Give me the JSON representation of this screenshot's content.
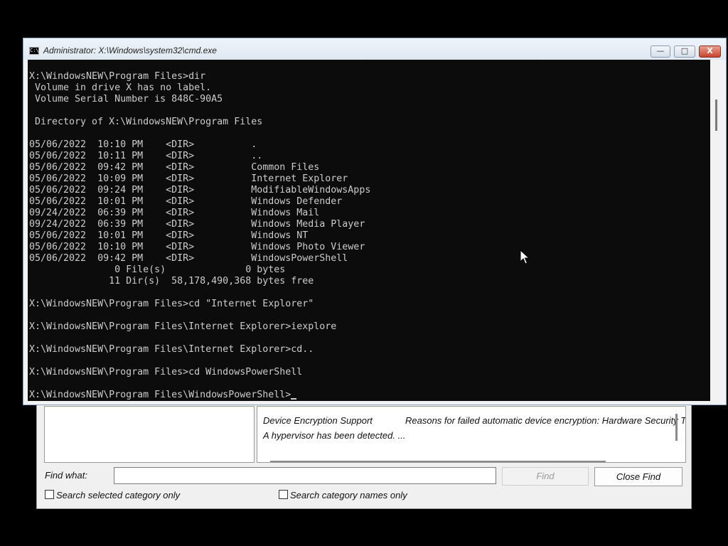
{
  "msinfo": {
    "row1_item": "Device Encryption Support",
    "row1_value": "Reasons for failed automatic device encryption: Hardware Security T",
    "row2_value": "A hypervisor has been detected. ...",
    "find_what_label": "Find what:",
    "find_what_value": "",
    "find_button": "Find",
    "close_find_button": "Close Find",
    "search_selected_label": "Search selected category only",
    "search_names_label": "Search category names only"
  },
  "cmd": {
    "title": "Administrator: X:\\Windows\\system32\\cmd.exe",
    "minimize_label": "—",
    "maximize_label": "□",
    "close_label": "X",
    "console_lines": [
      "",
      "X:\\WindowsNEW\\Program Files>dir",
      " Volume in drive X has no label.",
      " Volume Serial Number is 848C-90A5",
      "",
      " Directory of X:\\WindowsNEW\\Program Files",
      "",
      "05/06/2022  10:10 PM    <DIR>          .",
      "05/06/2022  10:11 PM    <DIR>          ..",
      "05/06/2022  09:42 PM    <DIR>          Common Files",
      "05/06/2022  10:09 PM    <DIR>          Internet Explorer",
      "05/06/2022  09:24 PM    <DIR>          ModifiableWindowsApps",
      "05/06/2022  10:01 PM    <DIR>          Windows Defender",
      "09/24/2022  06:39 PM    <DIR>          Windows Mail",
      "09/24/2022  06:39 PM    <DIR>          Windows Media Player",
      "05/06/2022  10:01 PM    <DIR>          Windows NT",
      "05/06/2022  10:10 PM    <DIR>          Windows Photo Viewer",
      "05/06/2022  09:42 PM    <DIR>          WindowsPowerShell",
      "               0 File(s)              0 bytes",
      "              11 Dir(s)  58,178,490,368 bytes free",
      "",
      "X:\\WindowsNEW\\Program Files>cd \"Internet Explorer\"",
      "",
      "X:\\WindowsNEW\\Program Files\\Internet Explorer>iexplore",
      "",
      "X:\\WindowsNEW\\Program Files\\Internet Explorer>cd..",
      "",
      "X:\\WindowsNEW\\Program Files>cd WindowsPowerShell",
      ""
    ],
    "prompt": "X:\\WindowsNEW\\Program Files\\WindowsPowerShell>"
  },
  "icons": {
    "cmd_icon": "console-icon",
    "pointer": "mouse-pointer-icon"
  }
}
